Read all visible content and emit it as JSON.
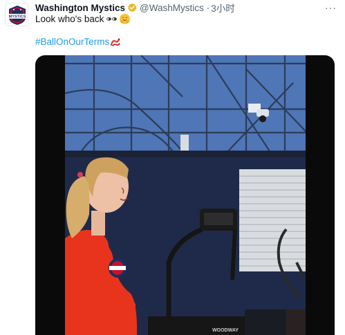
{
  "tweet": {
    "account_name": "Washington Mystics",
    "handle": "@WashMystics",
    "separator": "·",
    "time": "3小时",
    "text": "Look who's back",
    "hashtag": "#BallOnOurTerms",
    "more_label": "···",
    "icons": [
      "mystics-logo-icon",
      "verified-badge-icon",
      "eyes-icon",
      "hugging-face-icon",
      "hashtag-emoji-icon",
      "more-icon"
    ],
    "colors": {
      "link": "#1d9bf0",
      "secondary": "#536471",
      "verified": "#e8b923",
      "shirt": "#e8341c",
      "wall": "#1f2a4a"
    }
  },
  "logo": {
    "text": "MYSTICS"
  },
  "video": {
    "treadmill_brand": "WOODWAY"
  }
}
